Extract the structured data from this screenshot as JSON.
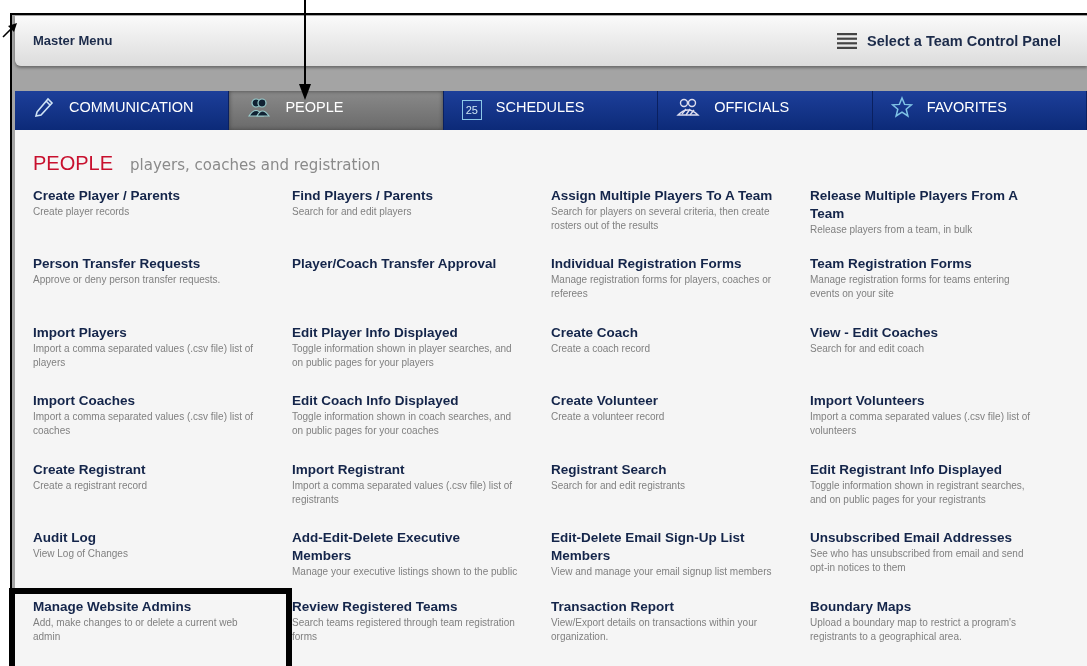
{
  "header": {
    "title": "Master Menu",
    "action": "Select a Team Control Panel"
  },
  "tabs": [
    {
      "label": "COMMUNICATION",
      "kind": "pencil",
      "selected": false
    },
    {
      "label": "PEOPLE",
      "kind": "people",
      "selected": true
    },
    {
      "label": "SCHEDULES",
      "kind": "calendar",
      "icon_text": "25",
      "selected": false
    },
    {
      "label": "OFFICIALS",
      "kind": "group",
      "selected": false
    },
    {
      "label": "FAVORITES",
      "kind": "star",
      "selected": false
    }
  ],
  "section": {
    "title": "PEOPLE",
    "subtitle": "players, coaches and registration"
  },
  "items": [
    {
      "title": "Create Player / Parents",
      "desc": "Create player records",
      "highlighted": false
    },
    {
      "title": "Find Players / Parents",
      "desc": "Search for and edit players",
      "highlighted": false
    },
    {
      "title": "Assign Multiple Players To A Team",
      "desc": "Search for players on several criteria, then create rosters out of the results",
      "highlighted": false
    },
    {
      "title": "Release Multiple Players From A Team",
      "desc": "Release players from a team, in bulk",
      "highlighted": false
    },
    {
      "title": "Person Transfer Requests",
      "desc": "Approve or deny person transfer requests.",
      "highlighted": false
    },
    {
      "title": "Player/Coach Transfer Approval",
      "highlighted": false
    },
    {
      "title": "Individual Registration Forms",
      "desc": "Manage registration forms for players, coaches or referees",
      "highlighted": false
    },
    {
      "title": "Team Registration Forms",
      "desc": "Manage registration forms for teams entering events on your site",
      "highlighted": false
    },
    {
      "title": "Import Players",
      "desc": "Import a comma separated values (.csv file) list of players",
      "highlighted": false
    },
    {
      "title": "Edit Player Info Displayed",
      "desc": "Toggle information shown in player searches, and on public pages for your players",
      "highlighted": false
    },
    {
      "title": "Create Coach",
      "desc": "Create a coach record",
      "highlighted": false
    },
    {
      "title": "View - Edit Coaches",
      "desc": "Search for and edit coach",
      "highlighted": false
    },
    {
      "title": "Import Coaches",
      "desc": "Import a comma separated values (.csv file) list of coaches",
      "highlighted": false
    },
    {
      "title": "Edit Coach Info Displayed",
      "desc": "Toggle information shown in coach searches, and on public pages for your coaches",
      "highlighted": false
    },
    {
      "title": "Create Volunteer",
      "desc": "Create a volunteer record",
      "highlighted": false
    },
    {
      "title": "Import Volunteers",
      "desc": "Import a comma separated values (.csv file) list of volunteers",
      "highlighted": false
    },
    {
      "title": "Create Registrant",
      "desc": "Create a registrant record",
      "highlighted": false
    },
    {
      "title": "Import Registrant",
      "desc": "Import a comma separated values (.csv file) list of registrants",
      "highlighted": false
    },
    {
      "title": "Registrant Search",
      "desc": "Search for and edit registrants",
      "highlighted": false
    },
    {
      "title": "Edit Registrant Info Displayed",
      "desc": "Toggle information shown in registrant searches, and on public pages for your registrants",
      "highlighted": false
    },
    {
      "title": "Audit Log",
      "desc": "View Log of Changes",
      "highlighted": false
    },
    {
      "title": "Add-Edit-Delete Executive Members",
      "desc": "Manage your executive listings shown to the public",
      "highlighted": false
    },
    {
      "title": "Edit-Delete Email Sign-Up List Members",
      "desc": "View and manage your email signup list members",
      "highlighted": false
    },
    {
      "title": "Unsubscribed Email Addresses",
      "desc": "See who has unsubscribed from email and send opt-in notices to them",
      "highlighted": false
    },
    {
      "title": "Manage Website Admins",
      "desc": "Add, make changes to or delete a current web admin",
      "highlighted": true
    },
    {
      "title": "Review Registered Teams",
      "desc": "Search teams registered through team registration forms",
      "highlighted": false
    },
    {
      "title": "Transaction Report",
      "desc": "View/Export details on transactions within your organization.",
      "highlighted": false
    },
    {
      "title": "Boundary Maps",
      "desc": "Upload a boundary map to restrict a program's registrants to a geographical area.",
      "highlighted": false
    }
  ]
}
